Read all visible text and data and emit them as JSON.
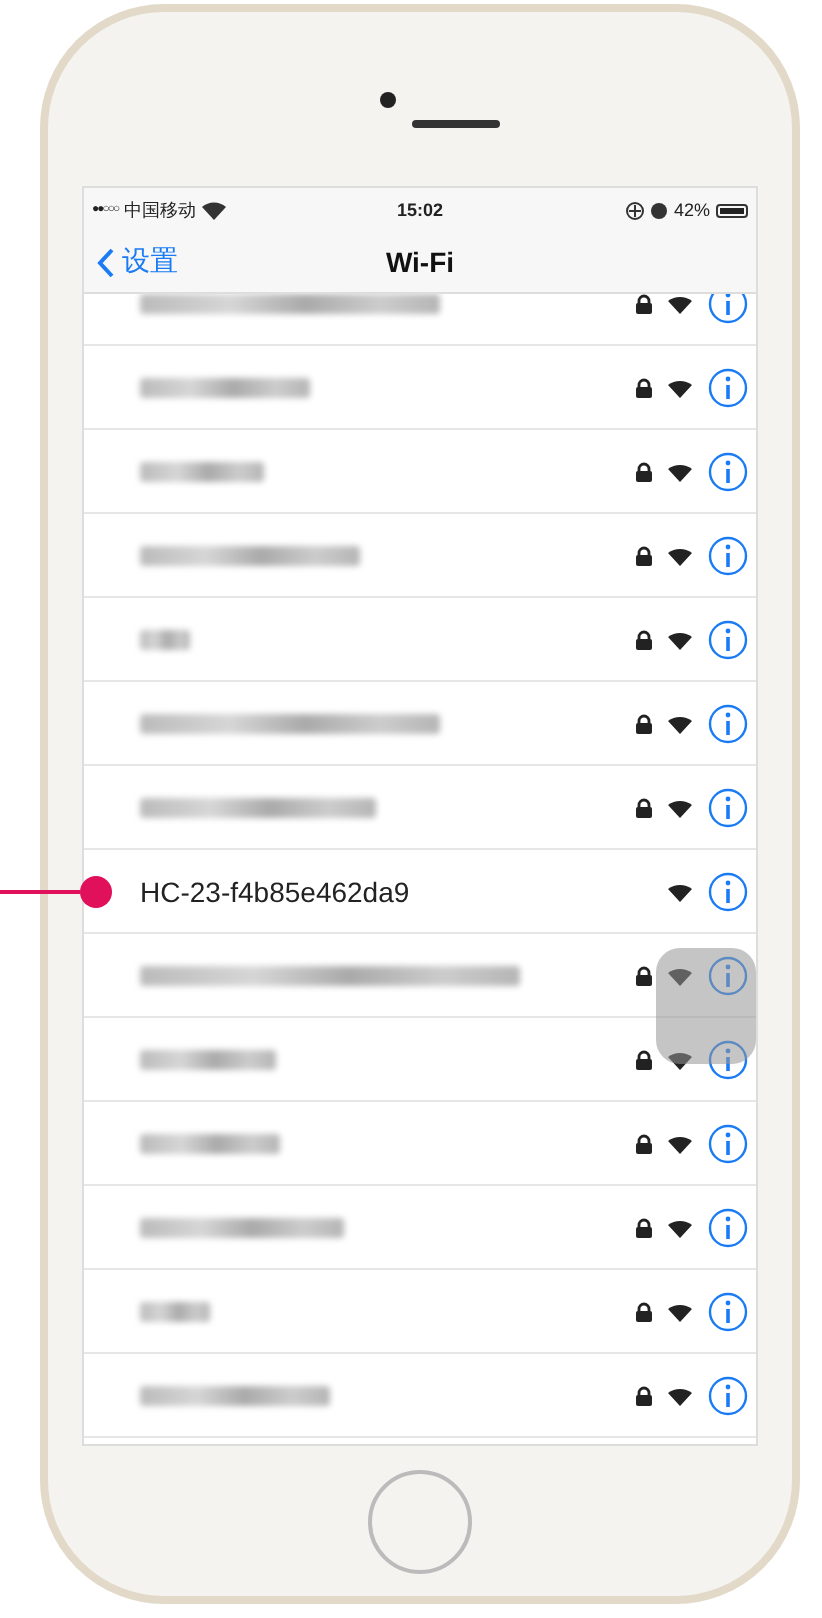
{
  "status_bar": {
    "signal": "●●○○○",
    "carrier": "中国移动",
    "time": "15:02",
    "battery": "42%"
  },
  "nav": {
    "back": "设置",
    "title": "Wi-Fi"
  },
  "networks": [
    {
      "kind": "blurred",
      "locked": true
    },
    {
      "kind": "blurred",
      "locked": true
    },
    {
      "kind": "blurred",
      "locked": true
    },
    {
      "kind": "blurred",
      "locked": true
    },
    {
      "kind": "blurred",
      "locked": true
    },
    {
      "kind": "blurred",
      "locked": true
    },
    {
      "kind": "blurred",
      "locked": true
    },
    {
      "kind": "named",
      "name": "HC-23-f4b85e462da9",
      "locked": false,
      "pointed": true
    },
    {
      "kind": "blurred",
      "locked": true
    },
    {
      "kind": "blurred",
      "locked": true
    },
    {
      "kind": "blurred",
      "locked": true
    },
    {
      "kind": "blurred",
      "locked": true
    },
    {
      "kind": "blurred",
      "locked": true
    },
    {
      "kind": "blurred",
      "locked": true
    }
  ]
}
